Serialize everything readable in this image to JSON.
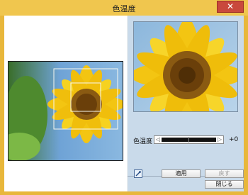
{
  "window": {
    "title": "色温度",
    "close_glyph": "✕"
  },
  "color_temp": {
    "label": "色温度",
    "value": "+0",
    "left_arrow": "◁",
    "right_arrow": "▷"
  },
  "buttons": {
    "apply": "適用",
    "revert": "戻す",
    "close": "閉じる"
  },
  "icons": {
    "eyedropper": "eyedropper-icon"
  }
}
